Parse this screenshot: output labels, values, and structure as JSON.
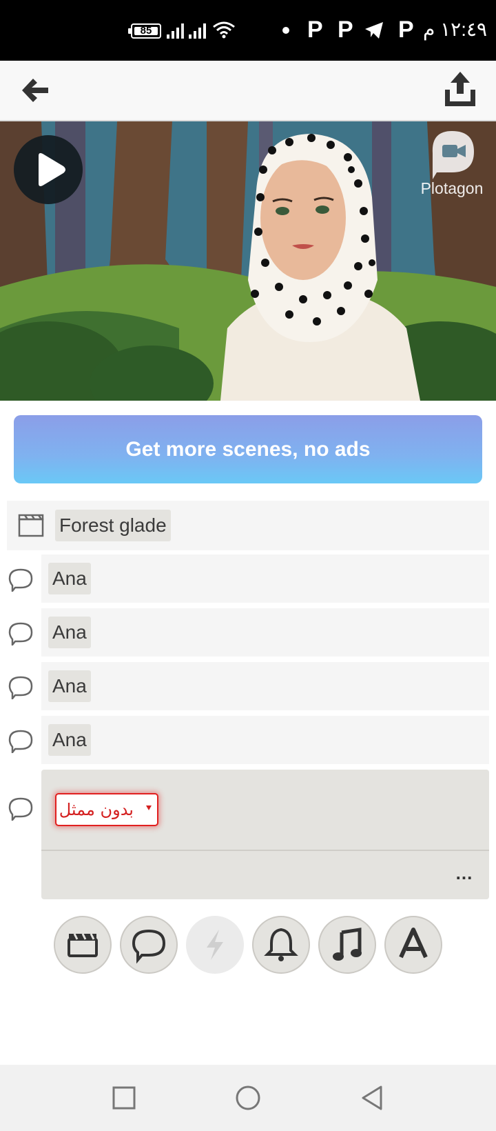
{
  "status_bar": {
    "battery_level": "85",
    "clock": "١٢:٤٩ م",
    "notification_glyphs": [
      "P",
      "P",
      "P"
    ]
  },
  "app_bar": {
    "back_icon": "arrow-left-icon",
    "share_icon": "share-upload-icon"
  },
  "player": {
    "play_icon": "play-icon",
    "brand": "Plotagon"
  },
  "promo": {
    "label": "Get more scenes, no ads"
  },
  "scene_row": {
    "icon": "clapperboard-icon",
    "location": "Forest glade"
  },
  "dialogue_lines": [
    {
      "actor": "Ana"
    },
    {
      "actor": "Ana"
    },
    {
      "actor": "Ana"
    },
    {
      "actor": "Ana"
    }
  ],
  "edit_line": {
    "actor_select": "بدون ممثل",
    "more_label": "..."
  },
  "toolbar": {
    "tools": [
      "clapperboard-icon",
      "speech-bubble-icon",
      "lightning-icon",
      "bell-icon",
      "music-note-icon",
      "text-a-icon"
    ]
  },
  "nav_bar": {
    "buttons": [
      "recents-square-icon",
      "home-circle-icon",
      "back-triangle-icon"
    ]
  },
  "colors": {
    "promo_gradient_start": "#8b9ee8",
    "promo_gradient_end": "#6ac8f6",
    "error_red": "#e11f1f",
    "row_bg": "#f5f5f5",
    "chip_bg": "#e4e3df"
  }
}
